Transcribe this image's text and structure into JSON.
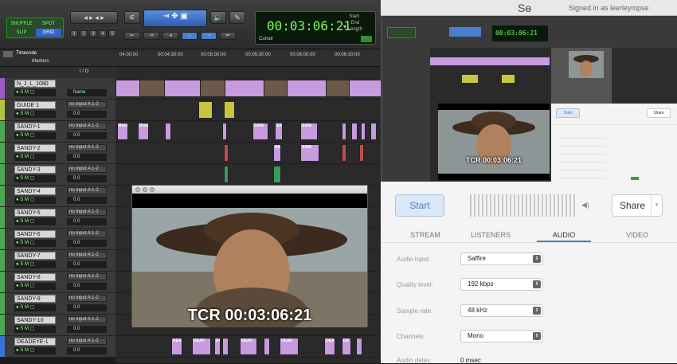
{
  "protools": {
    "mode_buttons": [
      "SHUFFLE",
      "SPOT",
      "SLIP",
      "GRID"
    ],
    "zoom_presets": [
      "1",
      "2",
      "3",
      "4",
      "5"
    ],
    "counter": {
      "main": "00:03:06:21",
      "start_label": "Start",
      "end_label": "End",
      "length_label": "Length",
      "cursor_label": "Cursor"
    },
    "ruler": {
      "title": "Timecode",
      "markers_label": "Markers",
      "io_label": "I / O",
      "ticks": [
        "04:00:00",
        "00:04:30:00",
        "00:05:00:00",
        "00:05:30:00",
        "00:06:00:00",
        "00:06:30:00"
      ]
    },
    "tracks": [
      {
        "name": "N_J_L_1080",
        "color": "#9c5cc4",
        "io": "",
        "vol": "frame"
      },
      {
        "name": "GUIDE 1",
        "color": "#b7c43a",
        "io": "no input A 1-2",
        "vol": "0.0"
      },
      {
        "name": "SANDY-1",
        "color": "#4fa84f",
        "io": "no input A 1-2",
        "vol": "0.0"
      },
      {
        "name": "SANDY-2",
        "color": "#4fa84f",
        "io": "no input A 1-2",
        "vol": "0.0"
      },
      {
        "name": "SANDY-3",
        "color": "#4fa84f",
        "io": "no input A 1-2",
        "vol": "0.0"
      },
      {
        "name": "SANDY-4",
        "color": "#4fa84f",
        "io": "no input A 1-2",
        "vol": "0.0"
      },
      {
        "name": "SANDY-5",
        "color": "#4fa84f",
        "io": "no input A 1-2",
        "vol": "0.0"
      },
      {
        "name": "SANDY-6",
        "color": "#4fa84f",
        "io": "no input A 1-2",
        "vol": "0.0"
      },
      {
        "name": "SANDY-7",
        "color": "#4fa84f",
        "io": "no input A 1-2",
        "vol": "0.0"
      },
      {
        "name": "SANDY-8",
        "color": "#4fa84f",
        "io": "no input A 1-2",
        "vol": "0.0"
      },
      {
        "name": "SANDY-9",
        "color": "#4fa84f",
        "io": "no input A 1-2",
        "vol": "0.0"
      },
      {
        "name": "SANDY-10",
        "color": "#4fa84f",
        "io": "no input A 1-2",
        "vol": "0.0"
      },
      {
        "name": "DEADEYE-1",
        "color": "#3f6fd8",
        "io": "no input A 1-2",
        "vol": "0.0"
      }
    ],
    "clip_labels": {
      "brea": "Brea",
      "sani": "SANI",
      "sa": "SA",
      "dea": "DEA",
      "dead": "DEAD",
      "de": "DE",
      "di": "DI"
    }
  },
  "video_window": {
    "timecode_overlay": "TCR 00:03:06:21"
  },
  "streaming_app": {
    "logo_text": "Sɵ",
    "signed_in_text": "Signed in as leerleympse",
    "start_label": "Start",
    "share_label": "Share",
    "tabs": [
      "STREAM",
      "LISTENERS",
      "AUDIO",
      "VIDEO"
    ],
    "active_tab": "AUDIO",
    "fields": [
      {
        "label": "Audio input:",
        "value": "Saffire"
      },
      {
        "label": "Quality level:",
        "value": "192 kbps"
      },
      {
        "label": "Sample rate:",
        "value": "48 kHz"
      },
      {
        "label": "Channels:",
        "value": "Mono"
      },
      {
        "label": "Audio delay:",
        "value": "0 msec"
      }
    ],
    "mini_tcr": "TCR 00:03:06:21"
  }
}
